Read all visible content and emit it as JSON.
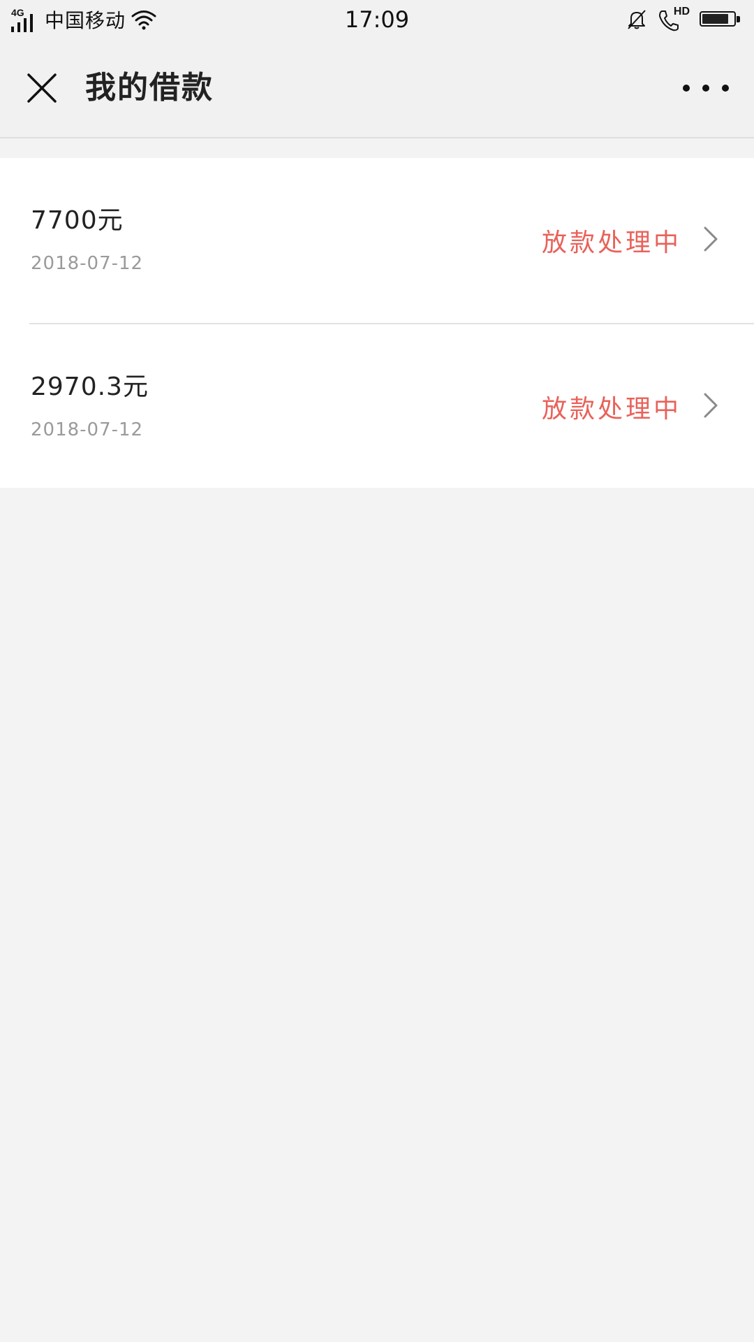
{
  "status_bar": {
    "network_type": "4G",
    "carrier": "中国移动",
    "time": "17:09",
    "hd_label": "HD",
    "battery_level": 0.85,
    "icons": [
      "signal-icon",
      "wifi-icon",
      "bell-muted-icon",
      "phone-icon",
      "battery-icon"
    ]
  },
  "nav": {
    "title": "我的借款",
    "close_icon": "close-icon",
    "more_icon": "more-icon"
  },
  "loans": [
    {
      "amount": "7700元",
      "date": "2018-07-12",
      "status": "放款处理中"
    },
    {
      "amount": "2970.3元",
      "date": "2018-07-12",
      "status": "放款处理中"
    }
  ],
  "colors": {
    "status_accent": "#e8625a",
    "background": "#f3f3f3",
    "card": "#ffffff",
    "date_gray": "#9a9a9a"
  }
}
